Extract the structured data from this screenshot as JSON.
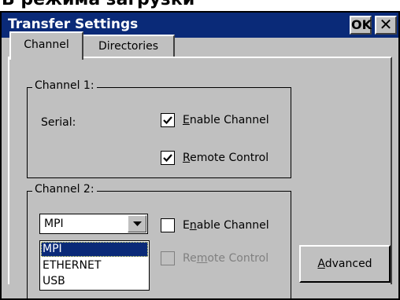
{
  "caption": "В режима загрузки",
  "window": {
    "title": "Transfer Settings",
    "ok_label": "OK",
    "close_label": "✕"
  },
  "tabs": [
    {
      "label": "Channel",
      "active": true
    },
    {
      "label": "Directories",
      "active": false
    }
  ],
  "channel1": {
    "legend": "Channel 1:",
    "type_label": "Serial:",
    "enable_channel": {
      "label_prefix": "",
      "mnemonic": "E",
      "label_rest": "nable Channel",
      "checked": true
    },
    "remote_control": {
      "label_prefix": "",
      "mnemonic": "R",
      "label_rest": "emote Control",
      "checked": true
    }
  },
  "channel2": {
    "legend": "Channel 2:",
    "protocol_value": "MPI",
    "protocol_options": [
      "MPI",
      "ETHERNET",
      "USB"
    ],
    "enable_channel": {
      "label_prefix": "E",
      "mnemonic": "n",
      "label_rest": "able Channel",
      "checked": false
    },
    "remote_control": {
      "label_prefix": "Re",
      "mnemonic": "m",
      "label_rest": "ote Control",
      "checked": false,
      "disabled": true
    }
  },
  "advanced_button": {
    "mnemonic": "A",
    "label_rest": "dvanced"
  },
  "colors": {
    "titlebar": "#0a2a78",
    "face": "#c0c0c0",
    "selection": "#0a2a78"
  }
}
